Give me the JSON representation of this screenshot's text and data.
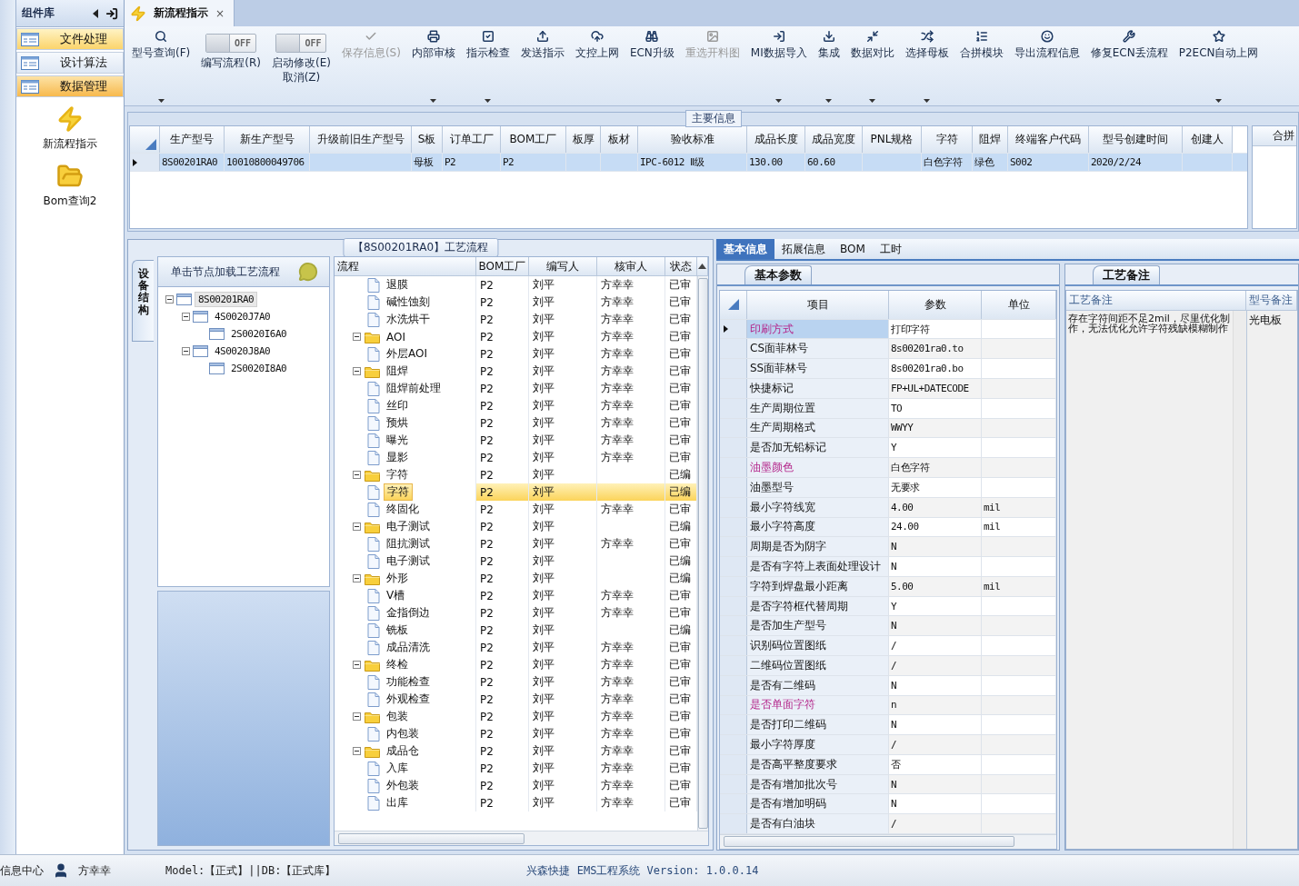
{
  "sidebar": {
    "title": "组件库",
    "items": [
      {
        "label": "文件处理",
        "selected": true,
        "hovered": false
      },
      {
        "label": "设计算法",
        "selected": false,
        "hovered": false
      },
      {
        "label": "数据管理",
        "selected": false,
        "hovered": true
      }
    ],
    "launchers": [
      {
        "label": "新流程指示"
      },
      {
        "label": "Bom查询2"
      }
    ]
  },
  "document_tabs": [
    {
      "label": "新流程指示",
      "close": "×",
      "selected": true
    }
  ],
  "toolbar": {
    "items": [
      {
        "kind": "button",
        "label": "型号查询(F)",
        "dropdown": true,
        "disabled": false
      },
      {
        "kind": "toggle",
        "label": "编写流程(R)",
        "switch_text": "OFF",
        "on": false
      },
      {
        "kind": "toggle",
        "label": "启动修改(E)\n取消(Z)",
        "switch_text": "OFF",
        "on": false
      },
      {
        "kind": "button",
        "label": "保存信息(S)",
        "dropdown": false,
        "disabled": true
      },
      {
        "kind": "button",
        "label": "内部审核",
        "dropdown": true,
        "disabled": false
      },
      {
        "kind": "button",
        "label": "指示检查",
        "dropdown": true,
        "disabled": false
      },
      {
        "kind": "button",
        "label": "发送指示",
        "dropdown": false,
        "disabled": false
      },
      {
        "kind": "button",
        "label": "文控上网",
        "dropdown": false,
        "disabled": false
      },
      {
        "kind": "button",
        "label": "ECN升级",
        "dropdown": false,
        "disabled": false
      },
      {
        "kind": "button",
        "label": "重选开料图",
        "dropdown": false,
        "disabled": true
      },
      {
        "kind": "button",
        "label": "MI数据导入",
        "dropdown": true,
        "disabled": false
      },
      {
        "kind": "button",
        "label": "集成",
        "dropdown": true,
        "disabled": false
      },
      {
        "kind": "button",
        "label": "数据对比",
        "dropdown": true,
        "disabled": false
      },
      {
        "kind": "button",
        "label": "选择母板",
        "dropdown": true,
        "disabled": false
      },
      {
        "kind": "button",
        "label": "合拼模块",
        "dropdown": false,
        "disabled": false
      },
      {
        "kind": "button",
        "label": "导出流程信息",
        "dropdown": false,
        "disabled": false
      },
      {
        "kind": "button",
        "label": "修复ECN丢流程",
        "dropdown": false,
        "disabled": false
      },
      {
        "kind": "button",
        "label": "P2ECN自动上网",
        "dropdown": true,
        "disabled": false
      }
    ]
  },
  "main_info": {
    "title": "主要信息",
    "columns": [
      "生产型号",
      "新生产型号",
      "升级前旧生产型号",
      "S板",
      "订单工厂",
      "BOM工厂",
      "板厚",
      "板材",
      "验收标准",
      "成品长度",
      "成品宽度",
      "PNL规格",
      "字符",
      "阻焊",
      "终端客户代码",
      "型号创建时间",
      "创建人"
    ],
    "rows": [
      {
        "selected": true,
        "cells": [
          "8S00201RA0",
          "10010800049706",
          null,
          "母板",
          "P2",
          "P2",
          null,
          null,
          "IPC-6012 Ⅱ级",
          "130.00",
          "60.60",
          null,
          "白色字符",
          "绿色",
          "S002",
          "2020/2/24",
          null
        ]
      }
    ],
    "side_column": "合拼"
  },
  "flow_panel": {
    "title": "【8S00201RA0】工艺流程",
    "side_tab": "设备结构",
    "tree_hint": "单击节点加载工艺流程",
    "structure_tree": [
      {
        "label": "8S00201RA0",
        "selected": true,
        "expanded": true,
        "children": [
          {
            "label": "4S0020J7A0",
            "selected": false,
            "expanded": true,
            "children": [
              {
                "label": "2S0020I6A0",
                "selected": false
              }
            ]
          },
          {
            "label": "4S0020J8A0",
            "selected": false,
            "expanded": true,
            "children": [
              {
                "label": "2S0020I8A0",
                "selected": false
              }
            ]
          }
        ]
      }
    ],
    "flow": {
      "columns": [
        "流程",
        "BOM工厂",
        "编写人",
        "核审人",
        "状态"
      ],
      "rows": [
        {
          "children": [
            {
              "name": "退膜",
              "bom": "P2",
              "writer": "刘平",
              "reviewer": "方幸幸",
              "status": "已审",
              "selected": false
            },
            {
              "name": "碱性蚀刻",
              "bom": "P2",
              "writer": "刘平",
              "reviewer": "方幸幸",
              "status": "已审",
              "selected": false
            },
            {
              "name": "水洗烘干",
              "bom": "P2",
              "writer": "刘平",
              "reviewer": "方幸幸",
              "status": "已审",
              "selected": false
            }
          ]
        },
        {
          "name": "AOI",
          "bom": "P2",
          "writer": "刘平",
          "reviewer": "方幸幸",
          "status": "已审",
          "expanded": true,
          "selected": false,
          "children": [
            {
              "name": "外层AOI",
              "bom": "P2",
              "writer": "刘平",
              "reviewer": "方幸幸",
              "status": "已审",
              "selected": false
            }
          ]
        },
        {
          "name": "阻焊",
          "bom": "P2",
          "writer": "刘平",
          "reviewer": "方幸幸",
          "status": "已审",
          "expanded": true,
          "selected": false,
          "children": [
            {
              "name": "阻焊前处理",
              "bom": "P2",
              "writer": "刘平",
              "reviewer": "方幸幸",
              "status": "已审",
              "selected": false
            },
            {
              "name": "丝印",
              "bom": "P2",
              "writer": "刘平",
              "reviewer": "方幸幸",
              "status": "已审",
              "selected": false
            },
            {
              "name": "预烘",
              "bom": "P2",
              "writer": "刘平",
              "reviewer": "方幸幸",
              "status": "已审",
              "selected": false
            },
            {
              "name": "曝光",
              "bom": "P2",
              "writer": "刘平",
              "reviewer": "方幸幸",
              "status": "已审",
              "selected": false
            },
            {
              "name": "显影",
              "bom": "P2",
              "writer": "刘平",
              "reviewer": "方幸幸",
              "status": "已审",
              "selected": false
            }
          ]
        },
        {
          "name": "字符",
          "bom": "P2",
          "writer": "刘平",
          "status": "已编",
          "expanded": true,
          "selected": false,
          "children": [
            {
              "name": "字符",
              "bom": "P2",
              "writer": "刘平",
              "status": "已编",
              "selected": true
            },
            {
              "name": "终固化",
              "bom": "P2",
              "writer": "刘平",
              "reviewer": "方幸幸",
              "status": "已审",
              "selected": false
            }
          ]
        },
        {
          "name": "电子测试",
          "bom": "P2",
          "writer": "刘平",
          "status": "已编",
          "expanded": true,
          "selected": false,
          "children": [
            {
              "name": "阻抗测试",
              "bom": "P2",
              "writer": "刘平",
              "reviewer": "方幸幸",
              "status": "已审",
              "selected": false
            },
            {
              "name": "电子测试",
              "bom": "P2",
              "writer": "刘平",
              "status": "已编",
              "selected": false
            }
          ]
        },
        {
          "name": "外形",
          "bom": "P2",
          "writer": "刘平",
          "status": "已编",
          "expanded": true,
          "selected": false,
          "children": [
            {
              "name": "V槽",
              "bom": "P2",
              "writer": "刘平",
              "reviewer": "方幸幸",
              "status": "已审",
              "selected": false
            },
            {
              "name": "金指倒边",
              "bom": "P2",
              "writer": "刘平",
              "reviewer": "方幸幸",
              "status": "已审",
              "selected": false
            },
            {
              "name": "铣板",
              "bom": "P2",
              "writer": "刘平",
              "status": "已编",
              "selected": false
            },
            {
              "name": "成品清洗",
              "bom": "P2",
              "writer": "刘平",
              "reviewer": "方幸幸",
              "status": "已审",
              "selected": false
            }
          ]
        },
        {
          "name": "终检",
          "bom": "P2",
          "writer": "刘平",
          "reviewer": "方幸幸",
          "status": "已审",
          "expanded": true,
          "selected": false,
          "children": [
            {
              "name": "功能检查",
              "bom": "P2",
              "writer": "刘平",
              "reviewer": "方幸幸",
              "status": "已审",
              "selected": false
            },
            {
              "name": "外观检查",
              "bom": "P2",
              "writer": "刘平",
              "reviewer": "方幸幸",
              "status": "已审",
              "selected": false
            }
          ]
        },
        {
          "name": "包装",
          "bom": "P2",
          "writer": "刘平",
          "reviewer": "方幸幸",
          "status": "已审",
          "expanded": true,
          "selected": false,
          "children": [
            {
              "name": "内包装",
              "bom": "P2",
              "writer": "刘平",
              "reviewer": "方幸幸",
              "status": "已审",
              "selected": false
            }
          ]
        },
        {
          "name": "成品仓",
          "bom": "P2",
          "writer": "刘平",
          "reviewer": "方幸幸",
          "status": "已审",
          "expanded": true,
          "selected": false,
          "children": [
            {
              "name": "入库",
              "bom": "P2",
              "writer": "刘平",
              "reviewer": "方幸幸",
              "status": "已审",
              "selected": false
            },
            {
              "name": "外包装",
              "bom": "P2",
              "writer": "刘平",
              "reviewer": "方幸幸",
              "status": "已审",
              "selected": false
            },
            {
              "name": "出库",
              "bom": "P2",
              "writer": "刘平",
              "reviewer": "方幸幸",
              "status": "已审",
              "selected": false
            }
          ]
        }
      ]
    }
  },
  "detail_panel": {
    "tabs": [
      {
        "label": "基本信息",
        "selected": true
      },
      {
        "label": "拓展信息",
        "selected": false
      },
      {
        "label": "BOM",
        "selected": false
      },
      {
        "label": "工时",
        "selected": false
      }
    ],
    "params": {
      "tab": "基本参数",
      "columns": [
        "项目",
        "参数",
        "单位"
      ],
      "rows": [
        {
          "item": "印刷方式",
          "value": "打印字符",
          "emphasized": true,
          "selected": true
        },
        {
          "item": "CS面菲林号",
          "value": "8s00201ra0.to",
          "emphasized": false,
          "selected": false
        },
        {
          "item": "SS面菲林号",
          "value": "8s00201ra0.bo",
          "emphasized": false,
          "selected": false
        },
        {
          "item": "快捷标记",
          "value": "FP+UL+DATECODE",
          "emphasized": false,
          "selected": false
        },
        {
          "item": "生产周期位置",
          "value": "TO",
          "emphasized": false,
          "selected": false
        },
        {
          "item": "生产周期格式",
          "value": "WWYY",
          "emphasized": false,
          "selected": false
        },
        {
          "item": "是否加无铅标记",
          "value": "Y",
          "emphasized": false,
          "selected": false
        },
        {
          "item": "油墨颜色",
          "value": "白色字符",
          "emphasized": true,
          "selected": false
        },
        {
          "item": "油墨型号",
          "value": "无要求",
          "emphasized": false,
          "selected": false
        },
        {
          "item": "最小字符线宽",
          "value": "4.00",
          "unit": "mil",
          "emphasized": false,
          "selected": false
        },
        {
          "item": "最小字符高度",
          "value": "24.00",
          "unit": "mil",
          "emphasized": false,
          "selected": false
        },
        {
          "item": "周期是否为阴字",
          "value": "N",
          "emphasized": false,
          "selected": false
        },
        {
          "item": "是否有字符上表面处理设计",
          "value": "N",
          "emphasized": false,
          "selected": false
        },
        {
          "item": "字符到焊盘最小距离",
          "value": "5.00",
          "unit": "mil",
          "emphasized": false,
          "selected": false
        },
        {
          "item": "是否字符框代替周期",
          "value": "Y",
          "emphasized": false,
          "selected": false
        },
        {
          "item": "是否加生产型号",
          "value": "N",
          "emphasized": false,
          "selected": false
        },
        {
          "item": "识别码位置图纸",
          "value": "/",
          "emphasized": false,
          "selected": false
        },
        {
          "item": "二维码位置图纸",
          "value": "/",
          "emphasized": false,
          "selected": false
        },
        {
          "item": "是否有二维码",
          "value": "N",
          "emphasized": false,
          "selected": false
        },
        {
          "item": "是否单面字符",
          "value": "n",
          "emphasized": true,
          "selected": false
        },
        {
          "item": "是否打印二维码",
          "value": "N",
          "emphasized": false,
          "selected": false
        },
        {
          "item": "最小字符厚度",
          "value": "/",
          "emphasized": false,
          "selected": false
        },
        {
          "item": "是否高平整度要求",
          "value": "否",
          "emphasized": false,
          "selected": false
        },
        {
          "item": "是否有增加批次号",
          "value": "N",
          "emphasized": false,
          "selected": false
        },
        {
          "item": "是否有增加明码",
          "value": "N",
          "emphasized": false,
          "selected": false
        },
        {
          "item": "是否有白油块",
          "value": "/",
          "emphasized": false,
          "selected": false
        }
      ]
    },
    "notes": {
      "tab": "工艺备注",
      "columns": [
        "工艺备注",
        "型号备注"
      ],
      "process_note": "存在字符间距不足2mil，尽里优化制作，无法优化允许字符残缺模糊制作",
      "model_note": "光电板"
    }
  },
  "status_bar": {
    "left": "信息中心",
    "user": "方幸幸",
    "environment": "Model:【正式】||DB:【正式库】",
    "product": "兴森快捷 EMS工程系统 Version: 1.0.0.14"
  }
}
